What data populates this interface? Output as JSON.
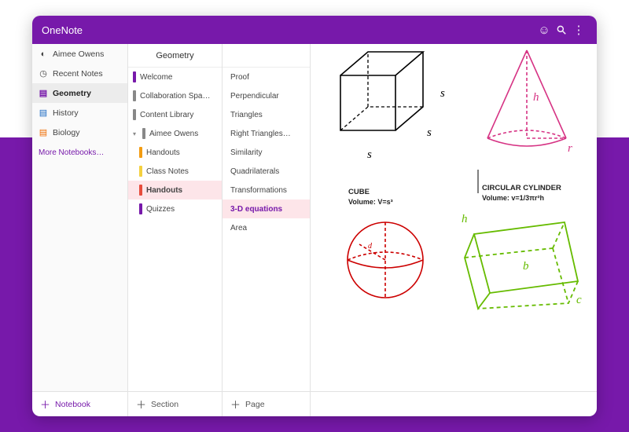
{
  "app": {
    "title": "OneNote"
  },
  "nav": {
    "user": "Aimee Owens",
    "recent": "Recent Notes",
    "notebooks": [
      {
        "label": "Geometry",
        "active": true
      },
      {
        "label": "History",
        "active": false
      },
      {
        "label": "Biology",
        "active": false
      }
    ],
    "more": "More Notebooks…"
  },
  "sections": {
    "title": "Geometry",
    "items": [
      {
        "label": "Welcome",
        "color": "purple"
      },
      {
        "label": "Collaboration Spa…",
        "color": "gray"
      },
      {
        "label": "Content Library",
        "color": "gray"
      },
      {
        "label": "Aimee Owens",
        "color": "gray",
        "caret": true
      },
      {
        "label": "Handouts",
        "color": "orange",
        "sub": true
      },
      {
        "label": "Class Notes",
        "color": "yellow",
        "sub": true
      },
      {
        "label": "Handouts",
        "color": "red",
        "sub": true,
        "selected": true
      },
      {
        "label": "Quizzes",
        "color": "purple",
        "sub": true
      }
    ]
  },
  "pages": {
    "items": [
      {
        "label": "Proof"
      },
      {
        "label": "Perpendicular"
      },
      {
        "label": "Triangles"
      },
      {
        "label": "Right Triangles…"
      },
      {
        "label": "Similarity"
      },
      {
        "label": "Quadrilaterals"
      },
      {
        "label": "Transformations"
      },
      {
        "label": "3-D equations",
        "selected": true
      },
      {
        "label": "Area"
      }
    ]
  },
  "footer": {
    "notebook": "Notebook",
    "section": "Section",
    "page": "Page"
  },
  "canvas": {
    "cube": {
      "title": "CUBE",
      "formula": "Volume: V=s³",
      "s": "s"
    },
    "cone": {
      "h": "h",
      "r": "r"
    },
    "cylinder": {
      "title": "CIRCULAR CYLINDER",
      "formula": "Volume: v=1/3πr²h"
    },
    "box": {
      "h": "h",
      "b": "b",
      "c": "c"
    },
    "sphere": {
      "d": "d"
    }
  }
}
